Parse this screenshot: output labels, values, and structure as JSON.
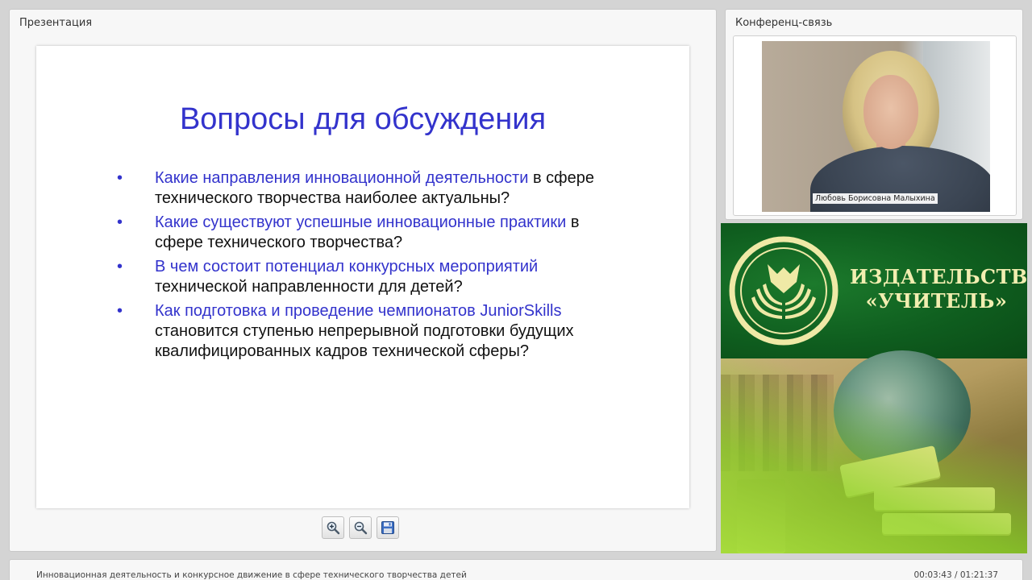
{
  "presentation": {
    "panel_title": "Презентация",
    "slide": {
      "title": "Вопросы для обсуждения",
      "bullets": [
        {
          "highlight": "Какие направления инновационной деятельности",
          "rest": " в сфере технического творчества наиболее актуальны?"
        },
        {
          "highlight": "Какие существуют успешные инновационные практики",
          "rest": " в сфере технического творчества?"
        },
        {
          "highlight": "В чем состоит потенциал конкурсных мероприятий",
          "rest": " технической направленности для детей?"
        },
        {
          "highlight": "Как  подготовка и проведение чемпионатов JuniorSkills",
          "rest": " становится ступенью  непрерывной подготовки будущих квалифицированных кадров технической сферы?"
        }
      ]
    },
    "toolbar": {
      "zoom_in_icon": "zoom-in-icon",
      "zoom_out_icon": "zoom-out-icon",
      "save_icon": "floppy-disk-icon"
    }
  },
  "conference": {
    "panel_title": "Конференц-связь",
    "speaker_name": "Любовь Борисовна Малыхина"
  },
  "banner": {
    "publisher_line1": "ИЗДАТЕЛЬСТВО",
    "publisher_line2": "«УЧИТЕЛЬ»",
    "colors": {
      "green": "#0f5e1f",
      "text": "#f2eeb0"
    }
  },
  "footer": {
    "webinar_title": "Инновационная деятельность и конкурсное движение в сфере технического творчества детей",
    "time": "00:03:43 / 01:21:37"
  },
  "colors": {
    "slide_accent": "#3333cc",
    "panel_bg": "#f7f7f7",
    "page_bg": "#d4d4d4"
  }
}
